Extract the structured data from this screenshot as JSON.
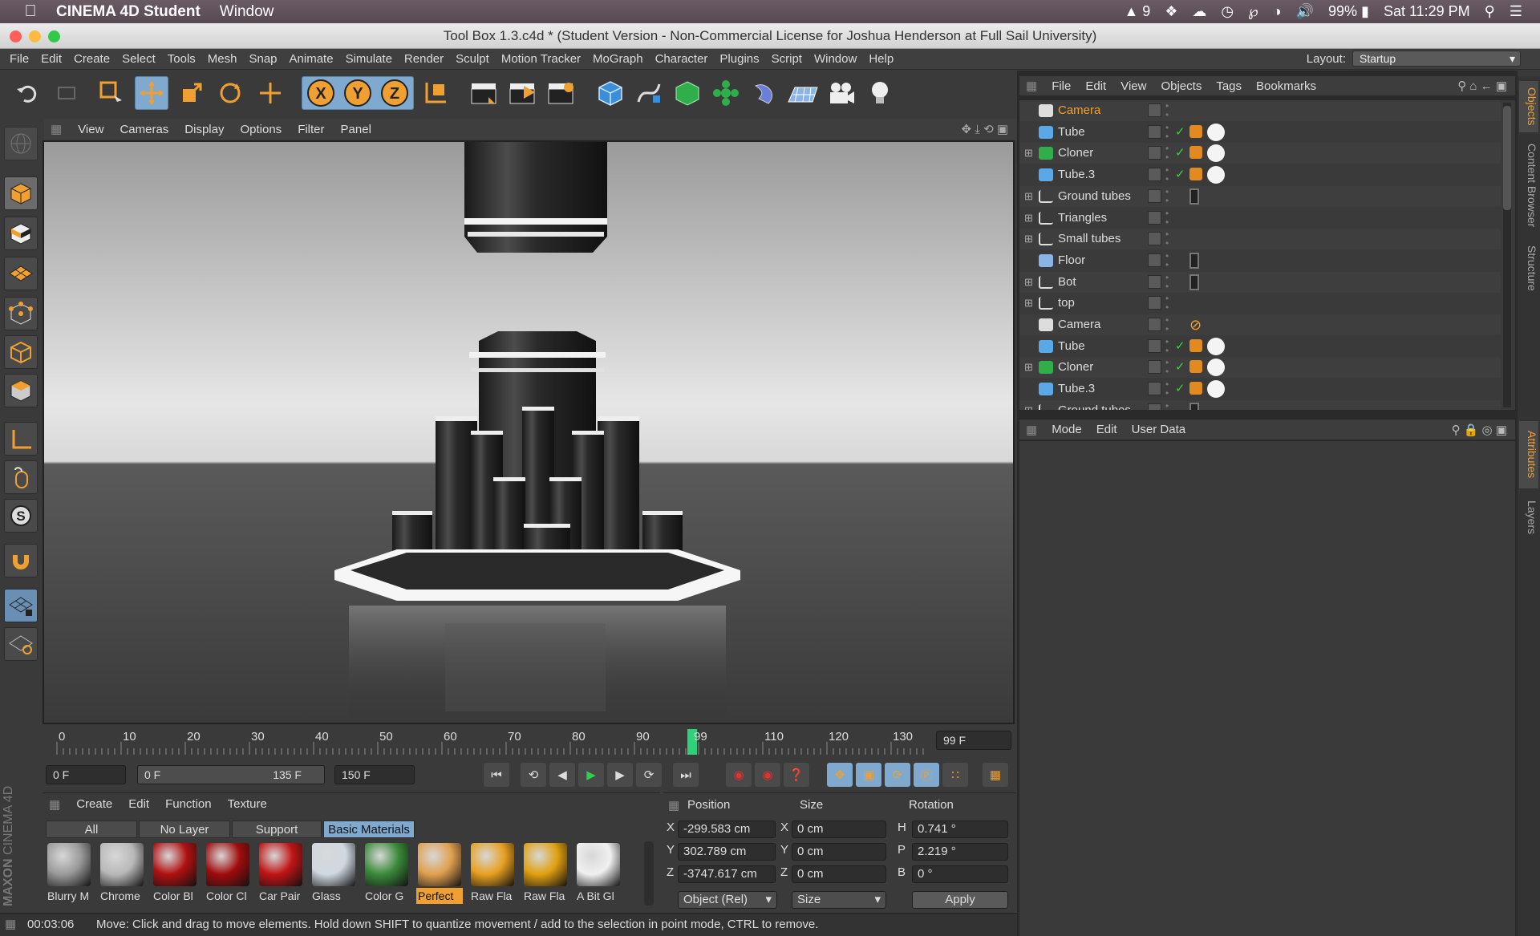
{
  "menubar": {
    "app_name": "CINEMA 4D Student",
    "menu_window": "Window",
    "battery": "99%",
    "notif_count": "9",
    "clock": "Sat 11:29 PM"
  },
  "window": {
    "title": "Tool Box 1.3.c4d * (Student Version - Non-Commercial License for Joshua Henderson at Full Sail University)"
  },
  "main_menu": [
    "File",
    "Edit",
    "Create",
    "Select",
    "Tools",
    "Mesh",
    "Snap",
    "Animate",
    "Simulate",
    "Render",
    "Sculpt",
    "Motion Tracker",
    "MoGraph",
    "Character",
    "Plugins",
    "Script",
    "Window",
    "Help"
  ],
  "layout": {
    "label": "Layout:",
    "value": "Startup"
  },
  "viewport_menu": [
    "View",
    "Cameras",
    "Display",
    "Options",
    "Filter",
    "Panel"
  ],
  "timeline": {
    "ticks": [
      "0",
      "10",
      "20",
      "30",
      "40",
      "50",
      "60",
      "70",
      "80",
      "90",
      "99",
      "110",
      "120",
      "130"
    ],
    "current": "99",
    "end_field": "99 F"
  },
  "transport": {
    "start": "0 F",
    "range_min": "0 F",
    "range_max": "135 F",
    "end": "150 F"
  },
  "material_manager": {
    "menu": [
      "Create",
      "Edit",
      "Function",
      "Texture"
    ],
    "tabs": [
      "All",
      "No Layer",
      "Support",
      "Basic Materials"
    ],
    "materials": [
      {
        "label": "Blurry M",
        "color": "#9a9a9a"
      },
      {
        "label": "Chrome",
        "color": "#b8b8b8"
      },
      {
        "label": "Color Bl",
        "color": "#b01010"
      },
      {
        "label": "Color Cl",
        "color": "#a00c0c"
      },
      {
        "label": "Car Pair",
        "color": "#c01414"
      },
      {
        "label": "Glass",
        "color": "#d0d8e0"
      },
      {
        "label": "Color G",
        "color": "#3a8a3a"
      },
      {
        "label": "Perfect",
        "color": "#e0a050"
      },
      {
        "label": "Raw Fla",
        "color": "#e8a020"
      },
      {
        "label": "Raw Fla",
        "color": "#e0a010"
      },
      {
        "label": "A Bit Gl",
        "color": "#f0f0f0"
      }
    ]
  },
  "coordinates": {
    "headers": [
      "Position",
      "Size",
      "Rotation"
    ],
    "rows": [
      {
        "axis": "X",
        "pos": "-299.583 cm",
        "saxis": "X",
        "size": "0 cm",
        "raxis": "H",
        "rot": "0.741 °"
      },
      {
        "axis": "Y",
        "pos": "302.789 cm",
        "saxis": "Y",
        "size": "0 cm",
        "raxis": "P",
        "rot": "2.219 °"
      },
      {
        "axis": "Z",
        "pos": "-3747.617 cm",
        "saxis": "Z",
        "size": "0 cm",
        "raxis": "B",
        "rot": "0 °"
      }
    ],
    "mode_select": "Object (Rel)",
    "size_select": "Size",
    "apply": "Apply"
  },
  "status": {
    "time": "00:03:06",
    "message": "Move: Click and drag to move elements. Hold down SHIFT to quantize movement / add to the selection in point mode, CTRL to remove."
  },
  "object_manager": {
    "menu": [
      "File",
      "Edit",
      "View",
      "Objects",
      "Tags",
      "Bookmarks"
    ],
    "objects": [
      {
        "name": "Camera",
        "icon": "camera",
        "selected": true
      },
      {
        "name": "Tube",
        "icon": "tube"
      },
      {
        "name": "Cloner",
        "icon": "cloner"
      },
      {
        "name": "Tube.3",
        "icon": "tube"
      },
      {
        "name": "Ground tubes",
        "icon": "null"
      },
      {
        "name": "Triangles",
        "icon": "null"
      },
      {
        "name": "Small tubes",
        "icon": "null"
      },
      {
        "name": "Floor",
        "icon": "floor"
      },
      {
        "name": "Bot",
        "icon": "null"
      },
      {
        "name": "top",
        "icon": "null"
      },
      {
        "name": "Camera",
        "icon": "camera"
      },
      {
        "name": "Tube",
        "icon": "tube"
      },
      {
        "name": "Cloner",
        "icon": "cloner"
      },
      {
        "name": "Tube.3",
        "icon": "tube"
      },
      {
        "name": "Ground tubes",
        "icon": "null"
      }
    ]
  },
  "attributes_menu": [
    "Mode",
    "Edit",
    "User Data"
  ],
  "right_tabs": [
    "Objects",
    "Content Browser",
    "Structure",
    "Attributes",
    "Layers"
  ],
  "brand": {
    "maxon": "MAXON",
    "c4d": "CINEMA 4D"
  },
  "accent": "#f0a030"
}
